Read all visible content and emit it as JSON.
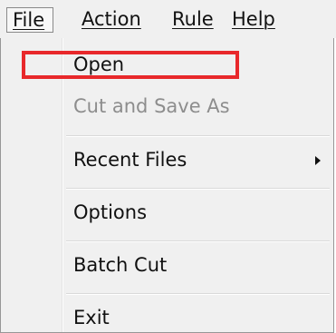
{
  "menubar": {
    "items": [
      {
        "label": "File"
      },
      {
        "label": "Action"
      },
      {
        "label": "Rule"
      },
      {
        "label": "Help"
      }
    ],
    "active": "File"
  },
  "file_menu": {
    "items": [
      {
        "label": "Open",
        "enabled": true
      },
      {
        "label": "Cut and Save As",
        "enabled": false
      },
      {
        "label": "Recent Files",
        "enabled": true,
        "submenu": true
      },
      {
        "label": "Options",
        "enabled": true
      },
      {
        "label": "Batch Cut",
        "enabled": true
      },
      {
        "label": "Exit",
        "enabled": true
      }
    ],
    "highlighted_item": "Open"
  },
  "colors": {
    "highlight_border": "#e8282b",
    "menu_background": "#f0f0f0",
    "disabled_text": "#8d8d8d"
  }
}
